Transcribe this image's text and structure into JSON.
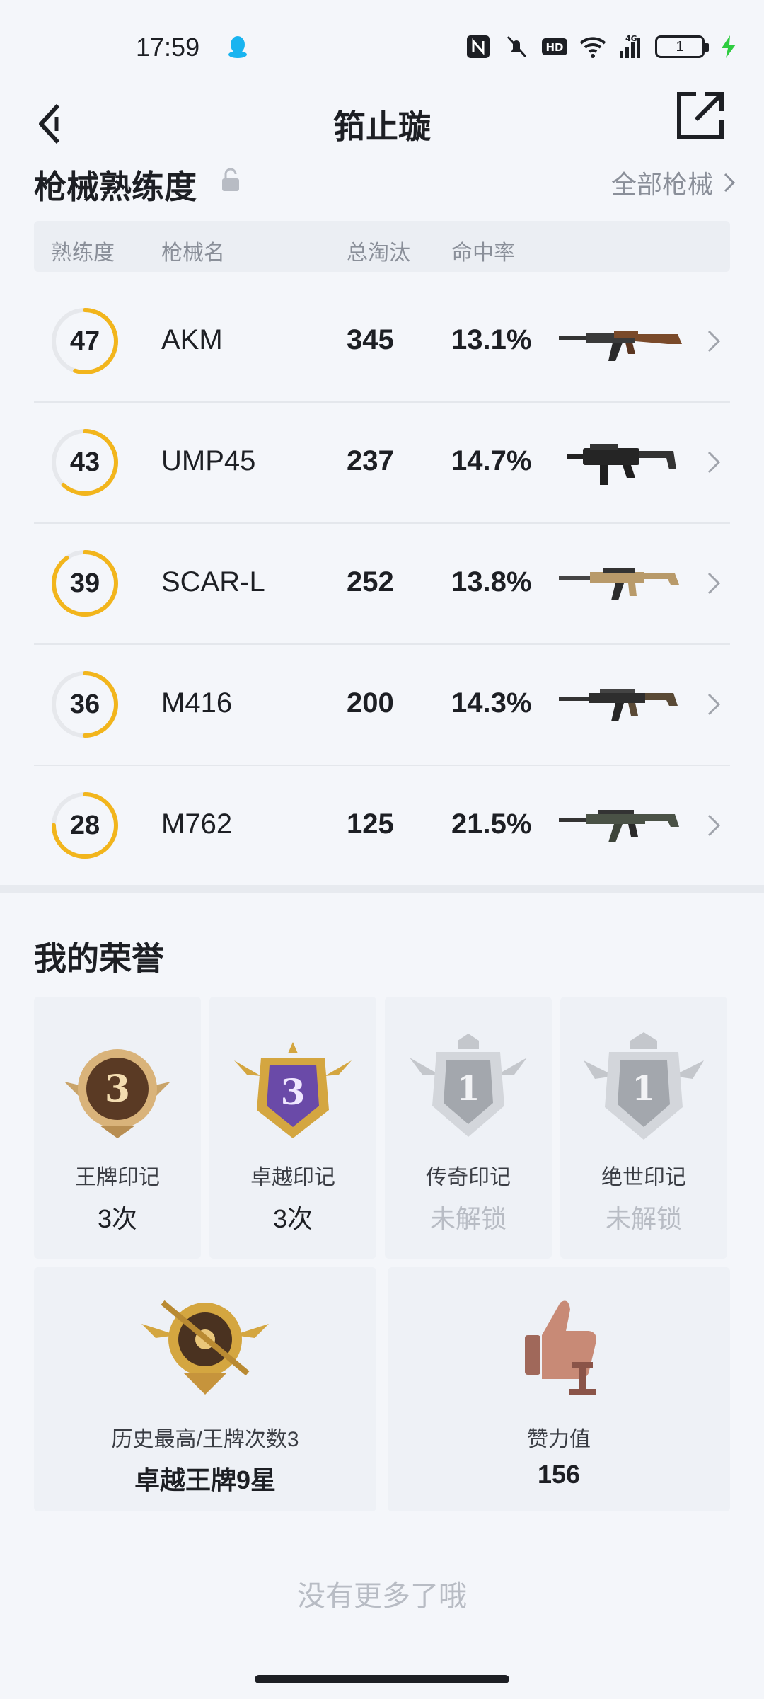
{
  "status_bar": {
    "time": "17:59",
    "battery": "1",
    "icons": [
      "qq-icon",
      "nfc-icon",
      "mute-icon",
      "hd-icon",
      "wifi-icon",
      "signal-4g-icon",
      "battery-icon",
      "charging-icon"
    ]
  },
  "nav": {
    "title": "筘止璇",
    "back_icon": "back-arrow-icon",
    "share_icon": "share-external-icon"
  },
  "weapons_section": {
    "title": "枪械熟练度",
    "all_link": "全部枪械",
    "columns": [
      "熟练度",
      "枪械名",
      "总淘汰",
      "命中率"
    ],
    "rows": [
      {
        "level": "47",
        "progress": 0.55,
        "name": "AKM",
        "kills": "345",
        "hit_rate": "13.1%"
      },
      {
        "level": "43",
        "progress": 0.62,
        "name": "UMP45",
        "kills": "237",
        "hit_rate": "14.7%"
      },
      {
        "level": "39",
        "progress": 0.9,
        "name": "SCAR-L",
        "kills": "252",
        "hit_rate": "13.8%"
      },
      {
        "level": "36",
        "progress": 0.5,
        "name": "M416",
        "kills": "200",
        "hit_rate": "14.3%"
      },
      {
        "level": "28",
        "progress": 0.75,
        "name": "M762",
        "kills": "125",
        "hit_rate": "21.5%"
      }
    ]
  },
  "honors_section": {
    "title": "我的荣誉",
    "badges": [
      {
        "label": "王牌印记",
        "value": "3次",
        "badge_number": "3",
        "locked": false
      },
      {
        "label": "卓越印记",
        "value": "3次",
        "badge_number": "3",
        "locked": false
      },
      {
        "label": "传奇印记",
        "value": "未解锁",
        "badge_number": "1",
        "locked": true
      },
      {
        "label": "绝世印记",
        "value": "未解锁",
        "badge_number": "1",
        "locked": true
      }
    ],
    "highest": {
      "label": "历史最高/王牌次数3",
      "value": "卓越王牌9星"
    },
    "likes": {
      "label": "赞力值",
      "value": "156"
    }
  },
  "footer": {
    "text": "没有更多了哦"
  },
  "colors": {
    "ring_active": "#f2b51c",
    "ring_track": "#e6e8ec",
    "muted": "#8a8f99",
    "locked": "#b8bcc4"
  }
}
